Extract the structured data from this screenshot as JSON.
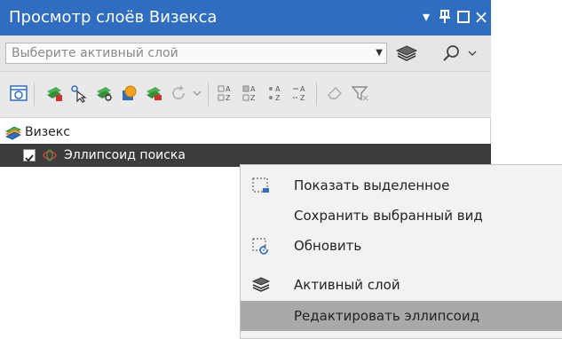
{
  "panel": {
    "title": "Просмотр слоёв Визекса",
    "title_buttons": {
      "dropdown": "▾",
      "pin": "⇩",
      "maximize": "☐",
      "close": "×"
    }
  },
  "search": {
    "placeholder": "Выберите активный слой"
  },
  "tree": {
    "root": {
      "label": "Визекс"
    },
    "child": {
      "label": "Эллипсоид поиска",
      "checked": true
    }
  },
  "context_menu": {
    "items": [
      {
        "label": "Показать выделенное",
        "icon": "show-selection-icon"
      },
      {
        "label": "Сохранить выбранный вид",
        "icon": ""
      },
      {
        "label": "Обновить",
        "icon": "refresh-icon"
      },
      {
        "label": "Активный слой",
        "icon": "layers-icon"
      },
      {
        "label": "Редактировать эллипсоид",
        "icon": "",
        "highlighted": true
      }
    ]
  },
  "colors": {
    "title_bar": "#2e6dc0",
    "selected_row": "#3c3c3c",
    "menu_highlight": "#a9a9a9"
  }
}
